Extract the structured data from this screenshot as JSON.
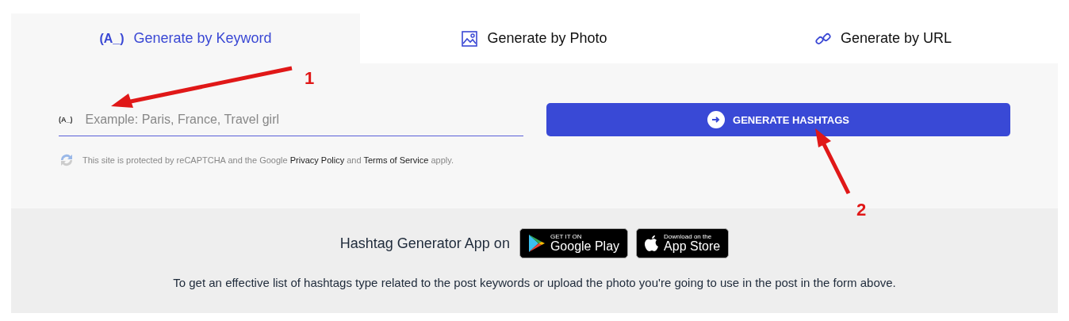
{
  "tabs": [
    {
      "kind": "keyword",
      "icon_text": "(A_)",
      "label": "Generate by Keyword",
      "selected": true
    },
    {
      "kind": "photo",
      "label": "Generate by Photo",
      "selected": false
    },
    {
      "kind": "url",
      "label": "Generate by URL",
      "selected": false
    }
  ],
  "keyword_field": {
    "icon_text": "(A_)",
    "placeholder": "Example: Paris, France, Travel girl"
  },
  "generate_button": "GENERATE HASHTAGS",
  "recaptcha_notice": {
    "before": "This site is protected by reCAPTCHA and the Google",
    "privacy_link": "Privacy Policy",
    "middle": "and",
    "terms_link": "Terms of Service",
    "after": "apply."
  },
  "app_promo": {
    "label": "Hashtag Generator App on",
    "badges": [
      {
        "kind": "google",
        "small": "GET IT ON",
        "big": "Google Play"
      },
      {
        "kind": "apple",
        "small": "Download on the",
        "big": "App Store"
      }
    ]
  },
  "description": "To get an effective list of hashtags type related to the post keywords or upload the photo you're going to use in the post in the form above.",
  "annotations": [
    {
      "label": "1"
    },
    {
      "label": "2"
    }
  ]
}
